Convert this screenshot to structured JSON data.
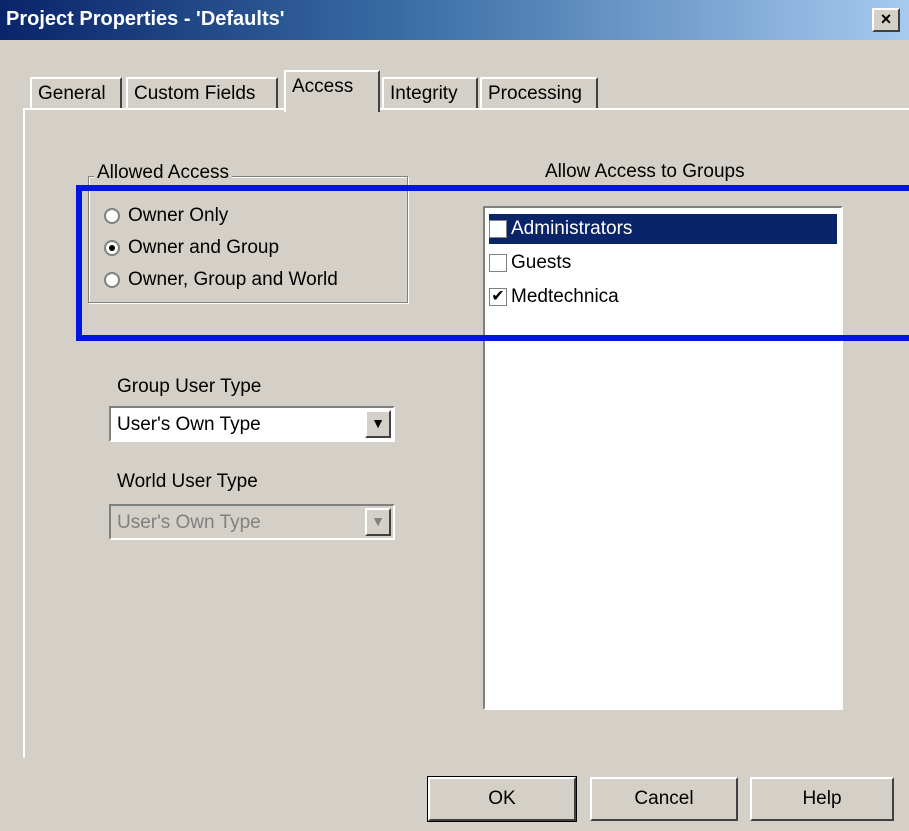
{
  "window": {
    "title": "Project Properties - 'Defaults'",
    "close_label": "×"
  },
  "tabs": [
    {
      "label": "General"
    },
    {
      "label": "Custom Fields"
    },
    {
      "label": "Access"
    },
    {
      "label": "Integrity"
    },
    {
      "label": "Processing"
    }
  ],
  "active_tab": "Access",
  "allowed_access": {
    "legend": "Allowed Access",
    "options": [
      {
        "label": "Owner Only",
        "checked": false
      },
      {
        "label": "Owner and Group",
        "checked": true
      },
      {
        "label": "Owner, Group and World",
        "checked": false
      }
    ]
  },
  "groups": {
    "heading": "Allow Access to Groups",
    "items": [
      {
        "label": "Administrators",
        "checked": false,
        "selected": true
      },
      {
        "label": "Guests",
        "checked": false,
        "selected": false
      },
      {
        "label": "Medtechnica",
        "checked": true,
        "selected": false
      }
    ]
  },
  "group_user_type": {
    "label": "Group User Type",
    "value": "User's Own Type"
  },
  "world_user_type": {
    "label": "World User Type",
    "value": "User's Own Type",
    "disabled": true
  },
  "buttons": {
    "ok": "OK",
    "cancel": "Cancel",
    "help": "Help"
  },
  "colors": {
    "titlebar": "#0a246a",
    "highlight": "#0016e0",
    "selection": "#0a246a"
  }
}
